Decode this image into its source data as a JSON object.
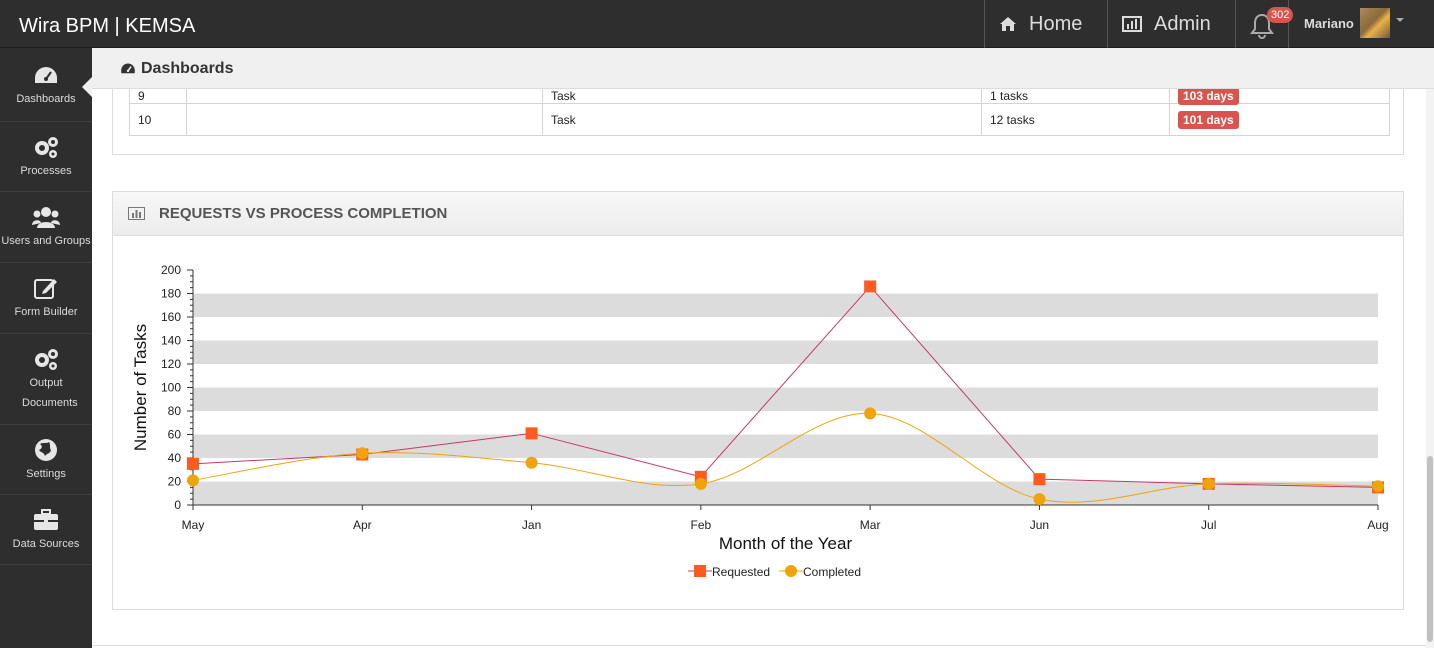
{
  "app": {
    "title": "Wira BPM | KEMSA"
  },
  "topnav": {
    "home_label": "Home",
    "admin_label": "Admin",
    "notification_count": "302",
    "user_name": "Mariano"
  },
  "sidebar": {
    "items": [
      {
        "label": "Dashboards",
        "icon": "dashboard-icon"
      },
      {
        "label": "Processes",
        "icon": "gears-icon"
      },
      {
        "label": "Users and Groups",
        "icon": "users-icon"
      },
      {
        "label": "Form Builder",
        "icon": "edit-icon"
      },
      {
        "label": "Output Documents",
        "icon": "gears-icon"
      },
      {
        "label": "Settings",
        "icon": "globe-icon"
      },
      {
        "label": "Data Sources",
        "icon": "briefcase-icon"
      }
    ]
  },
  "subheader": {
    "title": "Dashboards"
  },
  "task_table": {
    "rows": [
      {
        "num": "9",
        "name": "",
        "type": "Task",
        "count": "1 tasks",
        "age": "103 days"
      },
      {
        "num": "10",
        "name": "",
        "type": "Task",
        "count": "12 tasks",
        "age": "101 days"
      }
    ]
  },
  "chart_panel": {
    "title": "REQUESTS VS PROCESS COMPLETION"
  },
  "chart_data": {
    "type": "line",
    "title": "",
    "xlabel": "Month of the Year",
    "ylabel": "Number of Tasks",
    "categories": [
      "May",
      "Apr",
      "Jan",
      "Feb",
      "Mar",
      "Jun",
      "Jul",
      "Aug"
    ],
    "ylim": [
      0,
      200
    ],
    "yticks": [
      0,
      20,
      40,
      60,
      80,
      100,
      120,
      140,
      160,
      180,
      200
    ],
    "grid": "alternating horizontal bands",
    "legend_position": "bottom-center",
    "series": [
      {
        "name": "Requested",
        "values": [
          35,
          43,
          61,
          24,
          186,
          22,
          18,
          15
        ],
        "color": "#ff5a1f",
        "marker": "square",
        "line_color": "#c9356a"
      },
      {
        "name": "Completed",
        "values": [
          21,
          44,
          36,
          18,
          78,
          5,
          18,
          16
        ],
        "color": "#f0a30a",
        "marker": "circle",
        "line_color": "#f0a30a"
      }
    ]
  },
  "colors": {
    "topbar": "#2e2e2e",
    "badge": "#d9534f",
    "band": "#dcdcdc"
  }
}
